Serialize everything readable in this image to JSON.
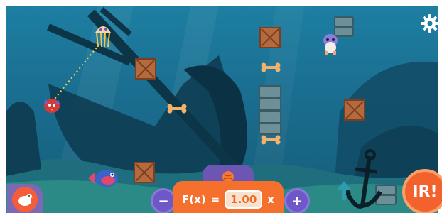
{
  "hud": {
    "formula_label": "F(x)",
    "equals": "=",
    "value": "1.00",
    "suffix": "x",
    "minus": "−",
    "plus": "+",
    "go_label": "IR!"
  },
  "icons": {
    "settings": "gear-icon",
    "character_select": "chicken-icon",
    "toggle": "ball-icon"
  },
  "colors": {
    "water_top": "#1d7fa2",
    "water_bottom": "#155c79",
    "hud_orange": "#f4702c",
    "hud_purple": "#6d55b3",
    "value_bg": "#f7e1cf"
  }
}
